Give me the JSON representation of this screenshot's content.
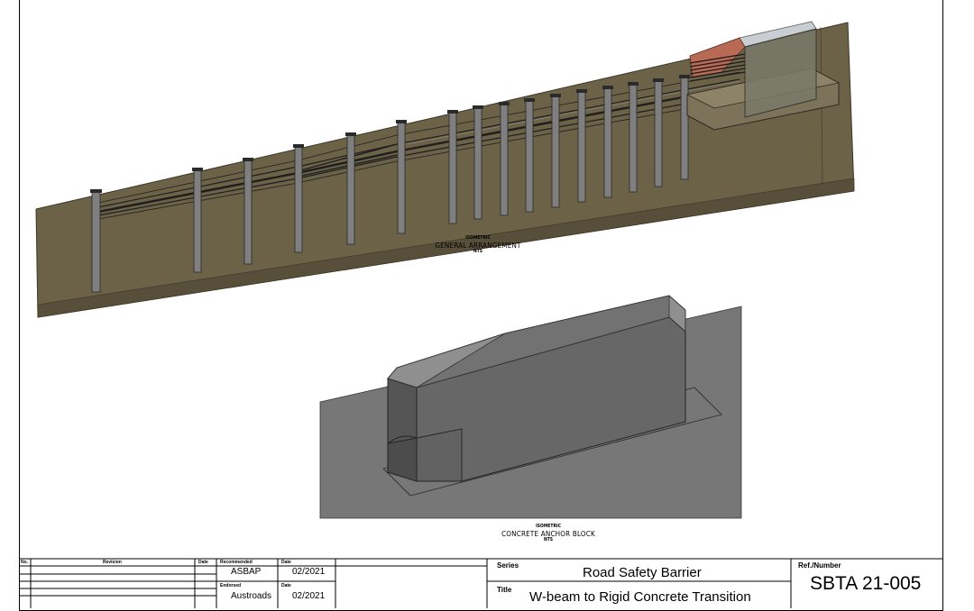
{
  "captions": {
    "iso1_view": "ISOMETRIC",
    "iso1_title": "GENERAL ARRANGEMENT",
    "iso1_scale": "NTS",
    "iso2_view": "ISOMETRIC",
    "iso2_title": "CONCRETE ANCHOR BLOCK",
    "iso2_scale": "NTS"
  },
  "title_block": {
    "no_label": "No.",
    "revision_label": "Revision",
    "date_label": "Date",
    "recommended_label": "Recommended",
    "recommended_value": "ASBAP",
    "recommended_date_label": "Date",
    "recommended_date": "02/2021",
    "endorsed_label": "Endorsed",
    "endorsed_value": "Austroads",
    "endorsed_date_label": "Date",
    "endorsed_date": "02/2021",
    "series_label": "Series",
    "series_value": "Road Safety Barrier",
    "title_label": "Title",
    "title_value": "W-beam to Rigid Concrete Transition",
    "ref_label": "Ref./Number",
    "ref_value": "SBTA 21-005"
  },
  "colors": {
    "ground": "#6b6248",
    "ground_edge": "#3c3627",
    "post": "#7f7f7f",
    "anchor_block": "#6a6a6a",
    "anchor_top": "#8c8c8c",
    "slab": "#7a7a7a",
    "terminal": "#b86a55"
  }
}
